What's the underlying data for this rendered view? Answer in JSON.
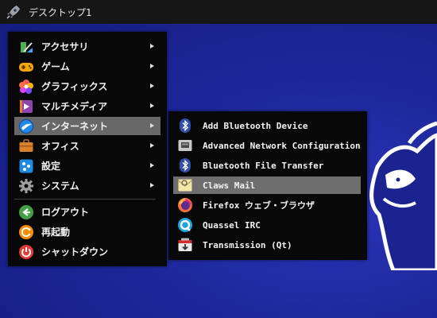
{
  "panel": {
    "title": "デスクトップ1",
    "icon": "rocket-icon"
  },
  "main_menu": {
    "items": [
      {
        "label": "アクセサリ",
        "icon": "accessories-icon",
        "submenu": true
      },
      {
        "label": "ゲーム",
        "icon": "gamepad-icon",
        "submenu": true
      },
      {
        "label": "グラフィックス",
        "icon": "graphics-icon",
        "submenu": true
      },
      {
        "label": "マルチメディア",
        "icon": "multimedia-icon",
        "submenu": true
      },
      {
        "label": "インターネット",
        "icon": "internet-icon",
        "submenu": true,
        "active": true
      },
      {
        "label": "オフィス",
        "icon": "office-icon",
        "submenu": true
      },
      {
        "label": "設定",
        "icon": "settings-icon",
        "submenu": true
      },
      {
        "label": "システム",
        "icon": "system-gear-icon",
        "submenu": true
      }
    ],
    "session_items": [
      {
        "label": "ログアウト",
        "icon": "logout-icon"
      },
      {
        "label": "再起動",
        "icon": "reboot-icon"
      },
      {
        "label": "シャットダウン",
        "icon": "shutdown-icon"
      }
    ]
  },
  "internet_submenu": {
    "items": [
      {
        "label": "Add Bluetooth Device",
        "icon": "bluetooth-icon"
      },
      {
        "label": "Advanced Network Configuration",
        "icon": "network-icon"
      },
      {
        "label": "Bluetooth File Transfer",
        "icon": "bluetooth-icon"
      },
      {
        "label": "Claws Mail",
        "icon": "mail-icon",
        "active": true
      },
      {
        "label": "Firefox ウェブ・ブラウザ",
        "icon": "firefox-icon"
      },
      {
        "label": "Quassel IRC",
        "icon": "quassel-icon"
      },
      {
        "label": "Transmission (Qt)",
        "icon": "transmission-icon"
      }
    ]
  },
  "colors": {
    "desktop": "#1a2390",
    "panel": "#161616",
    "menu_bg": "#080808",
    "highlight": "#686868"
  }
}
